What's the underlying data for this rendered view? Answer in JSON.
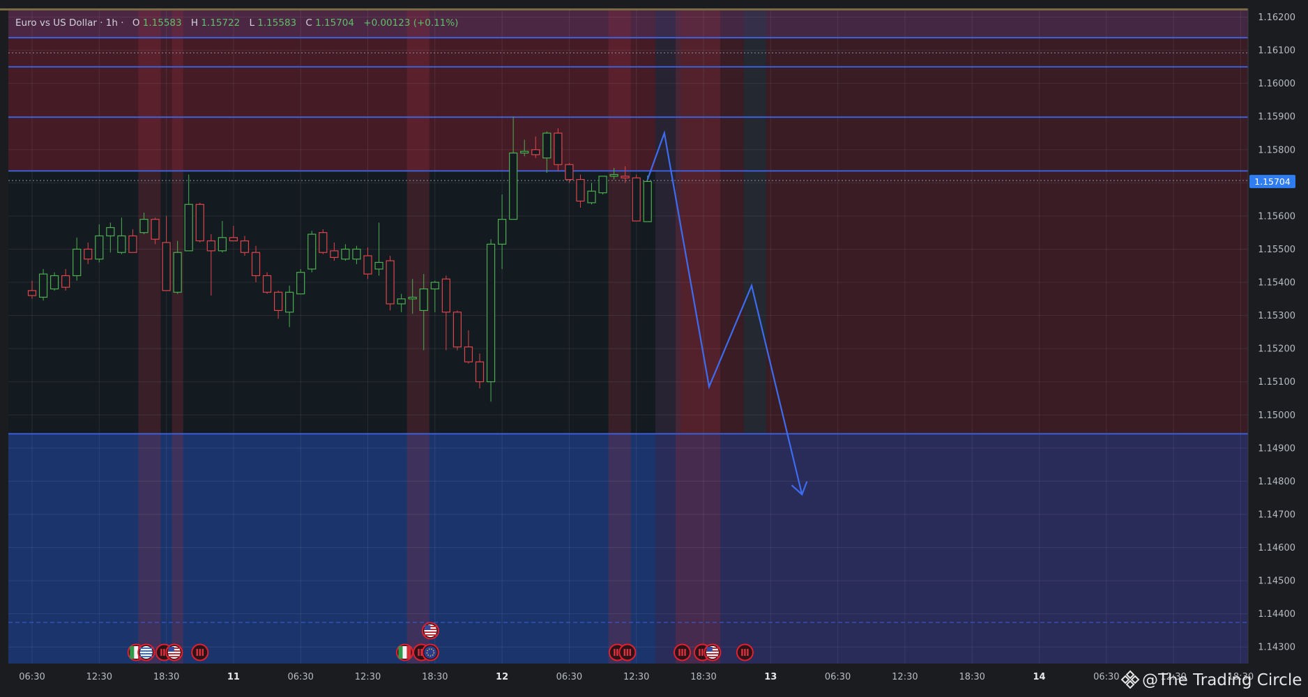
{
  "symbol_header": {
    "name": "Euro vs US Dollar · 1h ·",
    "o_label": "O",
    "o_value": "1.15583",
    "h_label": "H",
    "h_value": "1.15722",
    "l_label": "L",
    "l_value": "1.15583",
    "c_label": "C",
    "c_value": "1.15704",
    "change": "+0.00123 (+0.11%)"
  },
  "current_price": {
    "label": "1.15704",
    "value": 1.15704
  },
  "watermark": "@The Trading Circle",
  "colors": {
    "bull": "#4caf50",
    "bear": "#e0444c",
    "level_line": "#3d5fd6",
    "zone_red": "#6e1e2c",
    "zone_blue": "#1e3f86",
    "price_tag": "#2f7df0",
    "projection": "#3d6cf0"
  },
  "chart_data": {
    "type": "candlestick",
    "timeframe": "1h",
    "y_axis": {
      "range": [
        1.1425,
        1.1622
      ],
      "ticks": [
        "1.14300",
        "1.14400",
        "1.14500",
        "1.14600",
        "1.14700",
        "1.14800",
        "1.14900",
        "1.15000",
        "1.15100",
        "1.15200",
        "1.15300",
        "1.15400",
        "1.15500",
        "1.15600",
        "1.15800",
        "1.15900",
        "1.16000",
        "1.16100",
        "1.16200"
      ]
    },
    "x_axis": {
      "ticks": [
        {
          "label": "06:30",
          "h": 0
        },
        {
          "label": "12:30",
          "h": 6
        },
        {
          "label": "18:30",
          "h": 12
        },
        {
          "label": "11",
          "h": 18,
          "bold": true
        },
        {
          "label": "06:30",
          "h": 24
        },
        {
          "label": "12:30",
          "h": 30
        },
        {
          "label": "18:30",
          "h": 36
        },
        {
          "label": "12",
          "h": 42,
          "bold": true
        },
        {
          "label": "06:30",
          "h": 48
        },
        {
          "label": "12:30",
          "h": 54
        },
        {
          "label": "18:30",
          "h": 60
        },
        {
          "label": "13",
          "h": 66,
          "bold": true
        },
        {
          "label": "06:30",
          "h": 72
        },
        {
          "label": "12:30",
          "h": 78
        },
        {
          "label": "18:30",
          "h": 84
        },
        {
          "label": "14",
          "h": 90,
          "bold": true
        },
        {
          "label": "06:30",
          "h": 96
        },
        {
          "label": "12:30",
          "h": 102
        },
        {
          "label": "18:30",
          "h": 108
        }
      ]
    },
    "candles": [
      {
        "o": 1.15375,
        "h": 1.15405,
        "l": 1.1535,
        "c": 1.1536
      },
      {
        "o": 1.15355,
        "h": 1.1544,
        "l": 1.15345,
        "c": 1.15425
      },
      {
        "o": 1.1538,
        "h": 1.1543,
        "l": 1.15375,
        "c": 1.1542
      },
      {
        "o": 1.1542,
        "h": 1.1544,
        "l": 1.15375,
        "c": 1.15385
      },
      {
        "o": 1.1542,
        "h": 1.15535,
        "l": 1.15405,
        "c": 1.155
      },
      {
        "o": 1.155,
        "h": 1.1552,
        "l": 1.15455,
        "c": 1.1547
      },
      {
        "o": 1.1547,
        "h": 1.15575,
        "l": 1.1546,
        "c": 1.1554
      },
      {
        "o": 1.1554,
        "h": 1.1558,
        "l": 1.1549,
        "c": 1.15565
      },
      {
        "o": 1.1549,
        "h": 1.15595,
        "l": 1.15485,
        "c": 1.1554
      },
      {
        "o": 1.1554,
        "h": 1.1556,
        "l": 1.15495,
        "c": 1.1549
      },
      {
        "o": 1.1555,
        "h": 1.1561,
        "l": 1.15545,
        "c": 1.1559
      },
      {
        "o": 1.1559,
        "h": 1.15595,
        "l": 1.15515,
        "c": 1.1553
      },
      {
        "o": 1.1552,
        "h": 1.156,
        "l": 1.15485,
        "c": 1.15375
      },
      {
        "o": 1.1537,
        "h": 1.15525,
        "l": 1.15365,
        "c": 1.1549
      },
      {
        "o": 1.15495,
        "h": 1.15725,
        "l": 1.15495,
        "c": 1.15635
      },
      {
        "o": 1.15635,
        "h": 1.1564,
        "l": 1.1552,
        "c": 1.15525
      },
      {
        "o": 1.15525,
        "h": 1.15545,
        "l": 1.1536,
        "c": 1.15495
      },
      {
        "o": 1.15495,
        "h": 1.15585,
        "l": 1.1549,
        "c": 1.15535
      },
      {
        "o": 1.15535,
        "h": 1.1557,
        "l": 1.15525,
        "c": 1.15525
      },
      {
        "o": 1.15525,
        "h": 1.1554,
        "l": 1.1548,
        "c": 1.1549
      },
      {
        "o": 1.1549,
        "h": 1.1551,
        "l": 1.154,
        "c": 1.1542
      },
      {
        "o": 1.1542,
        "h": 1.1543,
        "l": 1.15365,
        "c": 1.1537
      },
      {
        "o": 1.1537,
        "h": 1.15375,
        "l": 1.1529,
        "c": 1.15315
      },
      {
        "o": 1.1531,
        "h": 1.1539,
        "l": 1.15265,
        "c": 1.1537
      },
      {
        "o": 1.15365,
        "h": 1.1544,
        "l": 1.15365,
        "c": 1.1543
      },
      {
        "o": 1.1544,
        "h": 1.15555,
        "l": 1.1543,
        "c": 1.15545
      },
      {
        "o": 1.1555,
        "h": 1.1556,
        "l": 1.15485,
        "c": 1.1549
      },
      {
        "o": 1.15495,
        "h": 1.1552,
        "l": 1.15465,
        "c": 1.15475
      },
      {
        "o": 1.1547,
        "h": 1.15515,
        "l": 1.15465,
        "c": 1.155
      },
      {
        "o": 1.1547,
        "h": 1.1551,
        "l": 1.15455,
        "c": 1.155
      },
      {
        "o": 1.1548,
        "h": 1.15505,
        "l": 1.1541,
        "c": 1.15425
      },
      {
        "o": 1.1544,
        "h": 1.1558,
        "l": 1.1542,
        "c": 1.1546
      },
      {
        "o": 1.15465,
        "h": 1.1548,
        "l": 1.15315,
        "c": 1.15335
      },
      {
        "o": 1.15335,
        "h": 1.15365,
        "l": 1.1531,
        "c": 1.1535
      },
      {
        "o": 1.1535,
        "h": 1.1541,
        "l": 1.15305,
        "c": 1.15355
      },
      {
        "o": 1.15315,
        "h": 1.15425,
        "l": 1.15195,
        "c": 1.1538
      },
      {
        "o": 1.1538,
        "h": 1.15405,
        "l": 1.1531,
        "c": 1.154
      },
      {
        "o": 1.1541,
        "h": 1.1542,
        "l": 1.15195,
        "c": 1.1531
      },
      {
        "o": 1.1531,
        "h": 1.15315,
        "l": 1.15195,
        "c": 1.15205
      },
      {
        "o": 1.15205,
        "h": 1.15255,
        "l": 1.15155,
        "c": 1.1516
      },
      {
        "o": 1.1516,
        "h": 1.15185,
        "l": 1.1508,
        "c": 1.151
      },
      {
        "o": 1.151,
        "h": 1.1553,
        "l": 1.1504,
        "c": 1.15515
      },
      {
        "o": 1.15515,
        "h": 1.15665,
        "l": 1.1544,
        "c": 1.1559
      },
      {
        "o": 1.1559,
        "h": 1.159,
        "l": 1.1559,
        "c": 1.1579
      },
      {
        "o": 1.1579,
        "h": 1.1583,
        "l": 1.1578,
        "c": 1.15795
      },
      {
        "o": 1.158,
        "h": 1.1584,
        "l": 1.15775,
        "c": 1.15785
      },
      {
        "o": 1.15775,
        "h": 1.15855,
        "l": 1.1573,
        "c": 1.1585
      },
      {
        "o": 1.1585,
        "h": 1.15865,
        "l": 1.15735,
        "c": 1.15755
      },
      {
        "o": 1.15755,
        "h": 1.1576,
        "l": 1.157,
        "c": 1.1571
      },
      {
        "o": 1.1571,
        "h": 1.15725,
        "l": 1.15625,
        "c": 1.15645
      },
      {
        "o": 1.1564,
        "h": 1.157,
        "l": 1.15635,
        "c": 1.15675
      },
      {
        "o": 1.1567,
        "h": 1.15705,
        "l": 1.15665,
        "c": 1.1572
      },
      {
        "o": 1.1572,
        "h": 1.15745,
        "l": 1.1571,
        "c": 1.15725
      },
      {
        "o": 1.1572,
        "h": 1.1575,
        "l": 1.157,
        "c": 1.15715
      },
      {
        "o": 1.15715,
        "h": 1.15725,
        "l": 1.15585,
        "c": 1.15585
      },
      {
        "o": 1.15583,
        "h": 1.15722,
        "l": 1.15583,
        "c": 1.15704
      }
    ],
    "levels": [
      {
        "price": 1.16138,
        "style": "solid"
      },
      {
        "price": 1.16092,
        "style": "dotted"
      },
      {
        "price": 1.1605,
        "style": "solid"
      },
      {
        "price": 1.15898,
        "style": "solid"
      },
      {
        "price": 1.15736,
        "style": "solid"
      },
      {
        "price": 1.15707,
        "style": "dotted"
      },
      {
        "price": 1.14943,
        "style": "solid"
      },
      {
        "price": 1.14374,
        "style": "dashed"
      }
    ],
    "zones": [
      {
        "type": "supply",
        "from": 1.15736,
        "to": 1.1622
      },
      {
        "type": "range",
        "from": 1.14943,
        "to": 1.15736
      },
      {
        "type": "demand",
        "from": 1.1425,
        "to": 1.14943
      }
    ],
    "session_bands": [
      {
        "from_h": 10,
        "to_h": 12
      },
      {
        "from_h": 13,
        "to_h": 14
      },
      {
        "from_h": 34,
        "to_h": 36
      },
      {
        "from_h": 52,
        "to_h": 54
      },
      {
        "from_h": 58,
        "to_h": 62
      }
    ],
    "projection_path": [
      {
        "h": 55.0,
        "price": 1.1571
      },
      {
        "h": 56.5,
        "price": 1.1585
      },
      {
        "h": 60.5,
        "price": 1.15085
      },
      {
        "h": 64.3,
        "price": 1.1539
      },
      {
        "h": 68.8,
        "price": 1.1476
      }
    ],
    "event_markers": [
      {
        "h": 9.3,
        "icon": "italy-flag-icon",
        "row": 0
      },
      {
        "h": 10.2,
        "icon": "greece-flag-icon",
        "row": 0
      },
      {
        "h": 11.8,
        "icon": "news-icon",
        "row": 0
      },
      {
        "h": 12.7,
        "icon": "usa-flag-icon",
        "row": 0
      },
      {
        "h": 15.0,
        "icon": "news-icon",
        "row": 0
      },
      {
        "h": 33.3,
        "icon": "italy-flag-icon",
        "row": 0
      },
      {
        "h": 34.8,
        "icon": "news-icon",
        "row": 0
      },
      {
        "h": 35.6,
        "icon": "eu-flag-icon",
        "row": 0
      },
      {
        "h": 35.6,
        "icon": "usa-flag-icon",
        "row": 1
      },
      {
        "h": 52.3,
        "icon": "news-icon",
        "row": 0
      },
      {
        "h": 53.2,
        "icon": "news-icon",
        "row": 0
      },
      {
        "h": 58.1,
        "icon": "news-icon",
        "row": 0
      },
      {
        "h": 59.9,
        "icon": "news-icon",
        "row": 0
      },
      {
        "h": 60.8,
        "icon": "usa-flag-icon",
        "row": 0
      },
      {
        "h": 63.7,
        "icon": "news-icon",
        "row": 0
      }
    ]
  }
}
